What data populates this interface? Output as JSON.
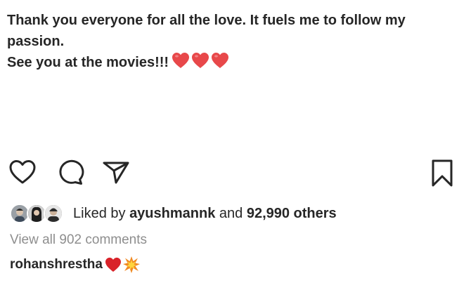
{
  "caption": {
    "line1": "Thank you everyone for all the love. It fuels me to follow my",
    "line2": "passion.",
    "line3": "See you at the movies!!!",
    "emoji": [
      "red-heart",
      "red-heart",
      "red-heart"
    ]
  },
  "actions": {
    "icons": [
      "heart-icon",
      "comment-icon",
      "share-icon",
      "bookmark-icon"
    ]
  },
  "likes": {
    "prefix": "Liked by",
    "user": "ayushmannk",
    "conjunction": "and",
    "count": "92,990 others"
  },
  "comments": {
    "view_all": "View all 902 comments",
    "first_user": "rohanshrestha",
    "first_emojis": [
      "red-heart",
      "collision"
    ]
  },
  "colors": {
    "text": "#262626",
    "muted": "#8e8e8e",
    "heart": "#e8484a"
  }
}
